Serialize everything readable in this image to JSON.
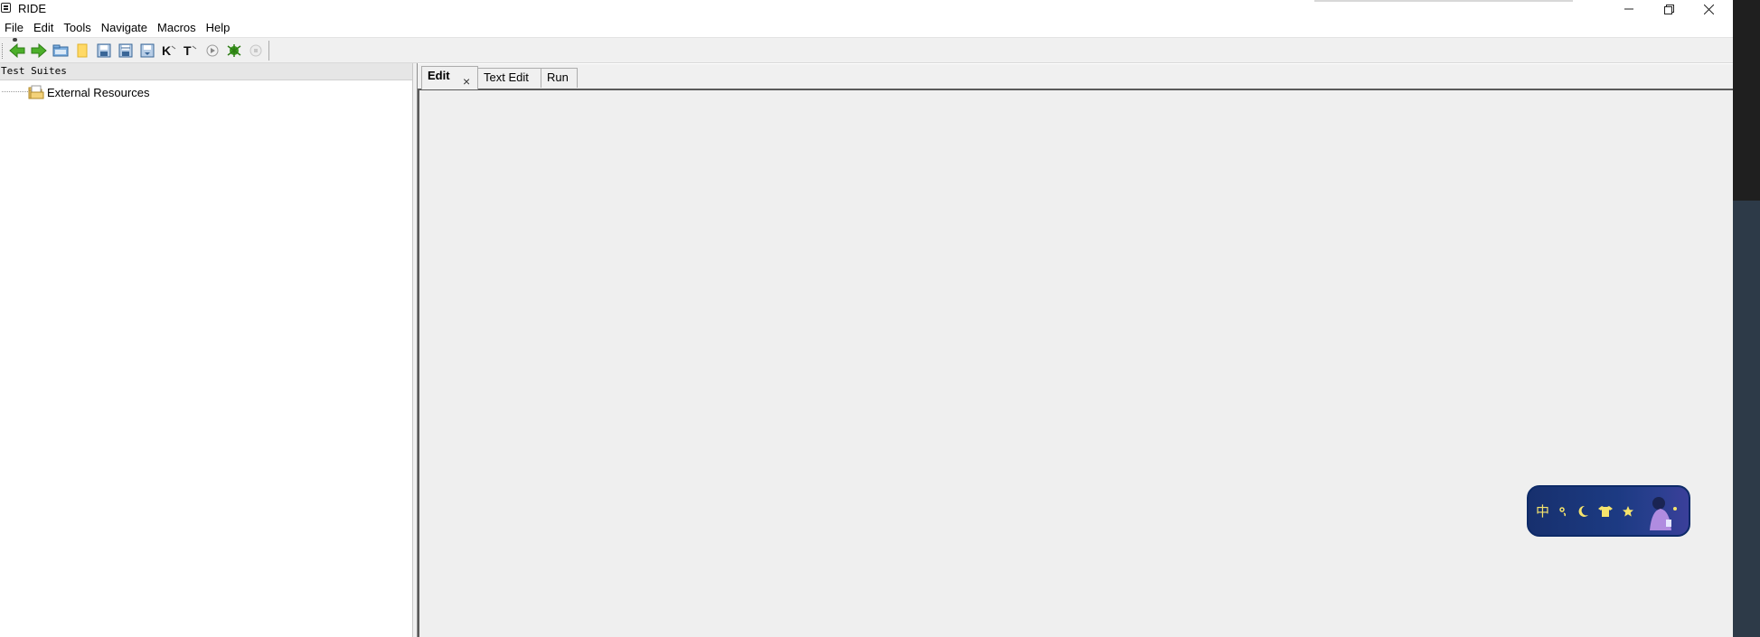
{
  "window": {
    "title": "RIDE",
    "controls": [
      "minimize",
      "maximize",
      "close"
    ]
  },
  "menu": {
    "items": [
      "File",
      "Edit",
      "Tools",
      "Navigate",
      "Macros",
      "Help"
    ]
  },
  "toolbar": {
    "buttons": [
      {
        "name": "back-icon"
      },
      {
        "name": "forward-icon"
      },
      {
        "name": "open-folder-icon"
      },
      {
        "name": "open-directory-icon"
      },
      {
        "name": "save-icon"
      },
      {
        "name": "save-all-icon"
      },
      {
        "name": "save-as-icon"
      },
      {
        "name": "search-keywords-icon"
      },
      {
        "name": "search-tests-icon"
      },
      {
        "name": "run-icon"
      },
      {
        "name": "debug-icon"
      },
      {
        "name": "stop-icon"
      }
    ]
  },
  "tree": {
    "header": "Test Suites",
    "items": [
      {
        "label": "External Resources",
        "icon": "folder-icon"
      }
    ]
  },
  "tabs": [
    {
      "label": "Edit",
      "active": true,
      "closable": true
    },
    {
      "label": "Text Edit",
      "active": false
    },
    {
      "label": "Run",
      "active": false
    }
  ],
  "ime": {
    "mode_label": "中"
  },
  "colors": {
    "accent_green": "#3a9a1e",
    "ime_background": "#1c3a82",
    "ime_glyph": "#f6e46c"
  }
}
